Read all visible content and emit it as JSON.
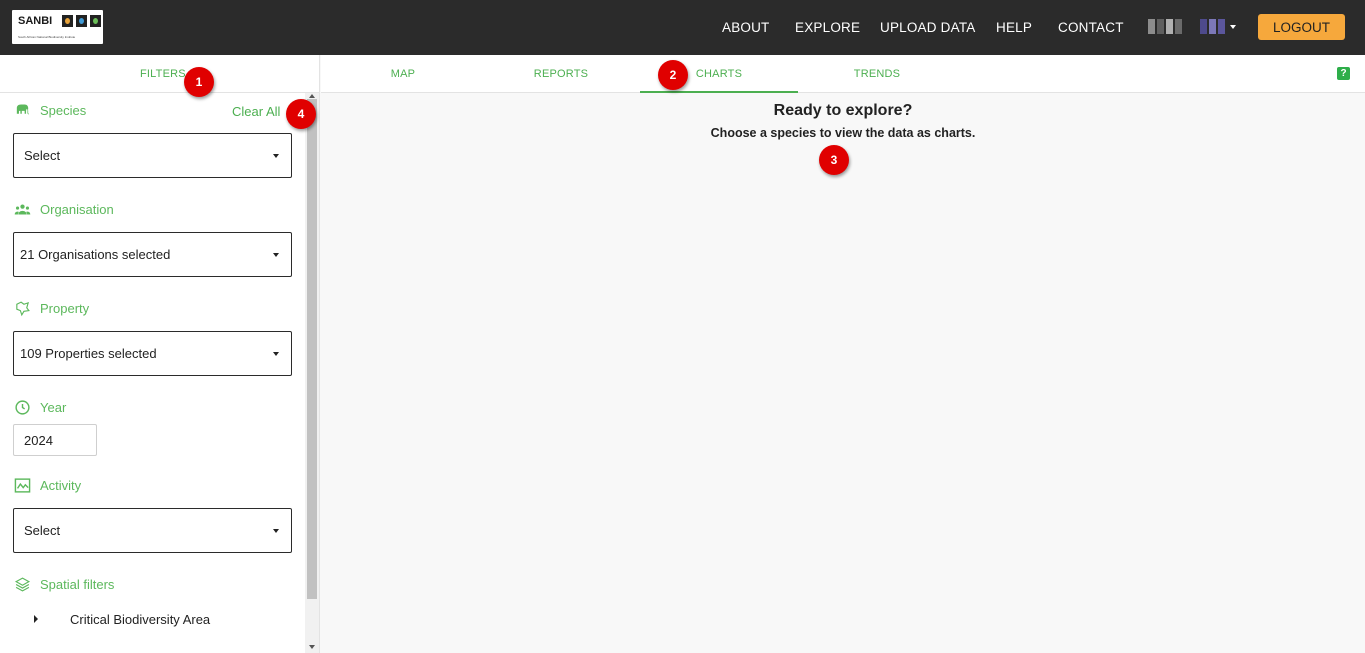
{
  "header": {
    "logo_text": "SANBI",
    "logo_subtext": "South African National Biodiversity Institute",
    "nav": [
      "ABOUT",
      "EXPLORE",
      "UPLOAD DATA",
      "HELP",
      "CONTACT"
    ],
    "logout_label": "LOGOUT",
    "accent_color": "#f6a83c"
  },
  "sidebar": {
    "tab_label": "FILTERS",
    "clear_all": "Clear All",
    "sections": {
      "species": {
        "label": "Species",
        "icon": "elephant-icon",
        "value": "Select"
      },
      "organisation": {
        "label": "Organisation",
        "icon": "people-icon",
        "value": "21 Organisations selected"
      },
      "property": {
        "label": "Property",
        "icon": "map-pin-icon",
        "value": "109 Properties selected"
      },
      "year": {
        "label": "Year",
        "icon": "clock-icon",
        "value": "2024"
      },
      "activity": {
        "label": "Activity",
        "icon": "activity-chart-icon",
        "value": "Select"
      },
      "spatial": {
        "label": "Spatial filters",
        "icon": "layers-icon"
      }
    },
    "spatial_items": [
      "Critical Biodiversity Area"
    ]
  },
  "tabs": [
    "MAP",
    "REPORTS",
    "CHARTS",
    "TRENDS"
  ],
  "active_tab": "CHARTS",
  "help_label": "?",
  "main": {
    "title": "Ready to explore?",
    "subtitle": "Choose a species to view the data as charts."
  },
  "callouts": [
    "1",
    "2",
    "3",
    "4"
  ],
  "colors": {
    "brand_green": "#4caf50",
    "callout_red": "#e00000",
    "topbar": "#2b2b2b"
  }
}
